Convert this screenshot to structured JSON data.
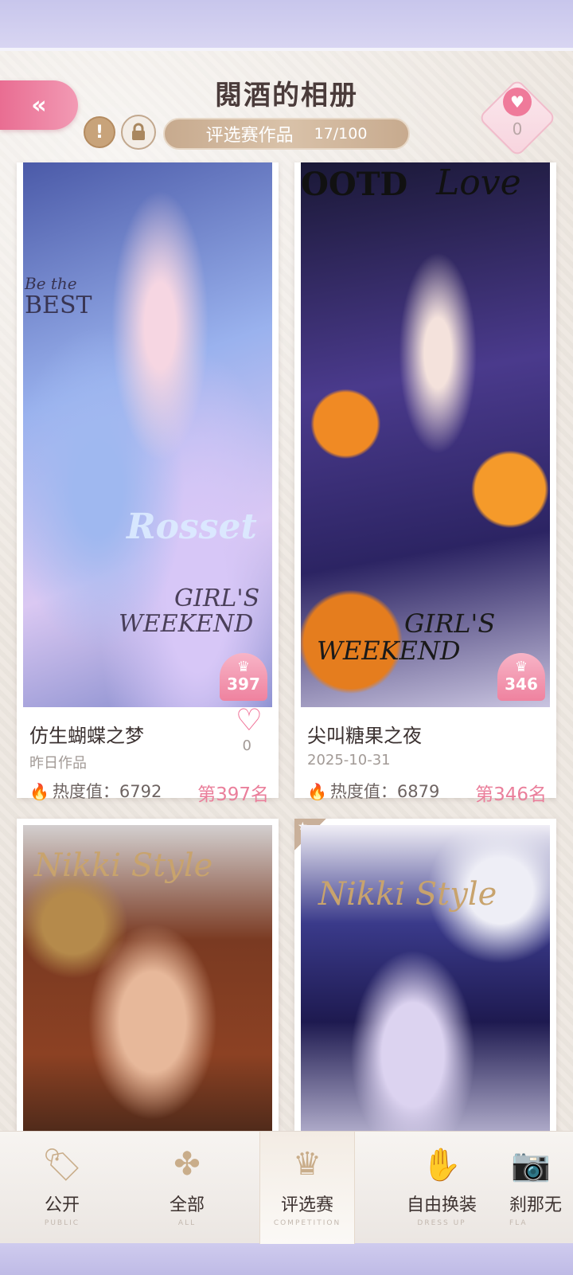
{
  "header": {
    "back_label": "«",
    "title": "閱酒的相册",
    "alert_label": "!",
    "lock_icon": "lock-icon",
    "counter_label": "评选赛作品",
    "counter_value": "17/100",
    "like_count": "0"
  },
  "cards": [
    {
      "title": "仿生蝴蝶之梦",
      "date": "昨日作品",
      "heat_label": "热度值：",
      "heat_value": "6792",
      "rank": "第397名",
      "badge_top_label": "TOP",
      "badge_num": "397",
      "heart_count": "0",
      "overlay_line1": "Be the",
      "overlay_line2": "BEST",
      "overlay_line3": "GIRL'S",
      "overlay_line4": "WEEKEND",
      "overlay_brand": "Rosset"
    },
    {
      "title": "尖叫糖果之夜",
      "date": "2025-10-31",
      "heat_label": "热度值：",
      "heat_value": "6879",
      "rank": "第346名",
      "badge_top_label": "TOP",
      "badge_num": "346",
      "overlay_line1": "OOTD",
      "overlay_line2": "Love",
      "overlay_line3": "GIRL'S",
      "overlay_line4": "WEEKEND"
    },
    {
      "overlay_brand": "Nikki Style"
    },
    {
      "overlay_brand": "Nikki Style"
    }
  ],
  "nav": [
    {
      "label": "公开",
      "sub": "PUBLIC",
      "icon": "tag-icon"
    },
    {
      "label": "全部",
      "sub": "ALL",
      "icon": "clover-icon"
    },
    {
      "label": "评选赛",
      "sub": "COMPETITION",
      "icon": "crown-icon"
    },
    {
      "label": "自由换装",
      "sub": "DRESS UP",
      "icon": "hand-icon"
    },
    {
      "label": "刹那无",
      "sub": "FLA",
      "icon": "camera-icon"
    }
  ]
}
